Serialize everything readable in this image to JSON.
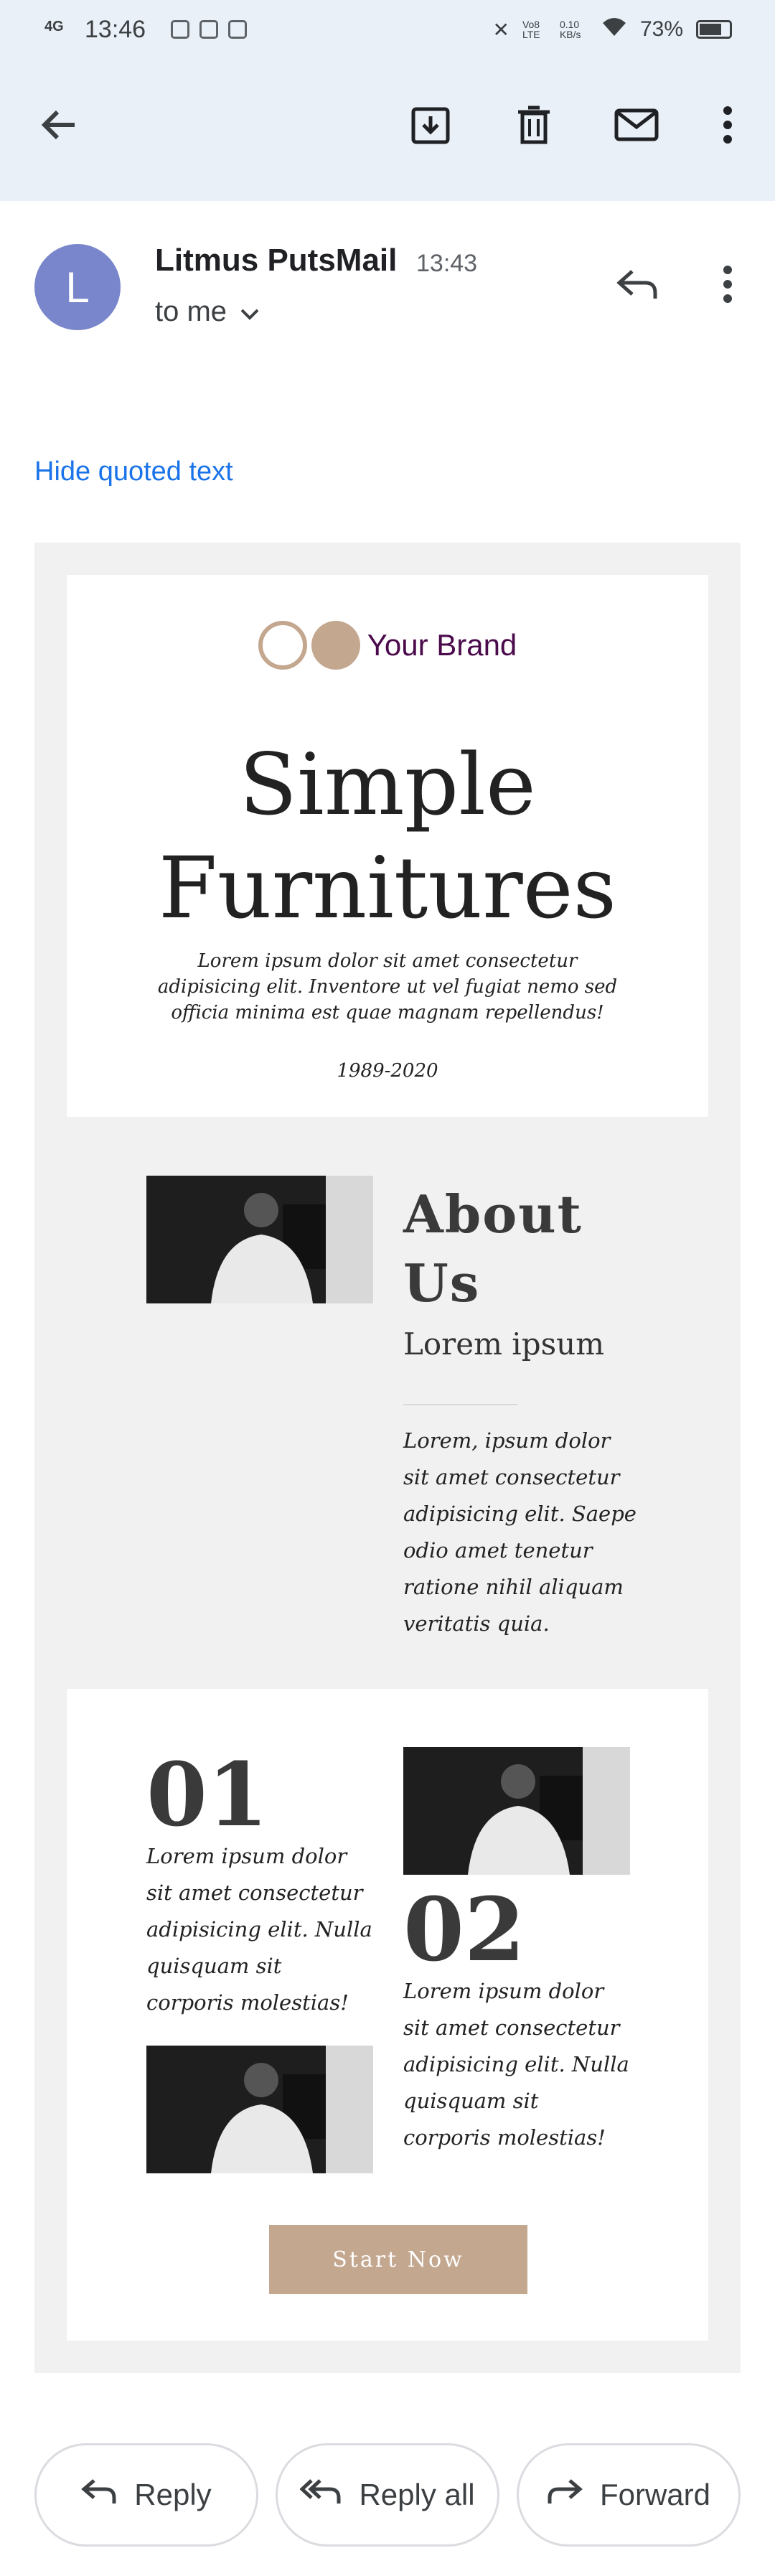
{
  "status_bar": {
    "network": "4G",
    "time": "13:46",
    "lte": "Vo8 LTE",
    "speed": "0.10 KB/s",
    "battery": "73%"
  },
  "app_bar": {
    "back_icon": "arrow-left-icon",
    "actions": [
      "archive-icon",
      "delete-icon",
      "mark-unread-icon",
      "more-vert-icon"
    ]
  },
  "message": {
    "avatar_letter": "L",
    "sender": "Litmus PutsMail",
    "time": "13:43",
    "recipient": "to me",
    "hide_quoted": "Hide quoted text"
  },
  "email_body": {
    "brand_name": "Your Brand",
    "hero_title_line1": "Simple",
    "hero_title_line2": "Furnitures",
    "hero_text": "Lorem ipsum dolor sit amet consectetur adipisicing elit. Inventore ut vel fugiat nemo sed officia minima est quae magnam repellendus!",
    "years": "1989-2020",
    "about_title_line1": "About",
    "about_title_line2": "Us",
    "about_subtitle": "Lorem ipsum",
    "about_text": "Lorem, ipsum dolor sit amet consectetur adipisicing elit. Saepe odio amet tenetur ratione nihil aliquam veritatis quia.",
    "feature1_number": "01",
    "feature1_text": "Lorem ipsum dolor sit amet consectetur adipisicing elit. Nulla quisquam sit corporis molestias!",
    "feature2_number": "02",
    "feature2_text": "Lorem ipsum dolor sit amet consectetur adipisicing elit. Nulla quisquam sit corporis molestias!",
    "cta_label": "Start Now",
    "brand_color": "#c4a78f"
  },
  "actions": {
    "reply": "Reply",
    "reply_all": "Reply all",
    "forward": "Forward"
  }
}
